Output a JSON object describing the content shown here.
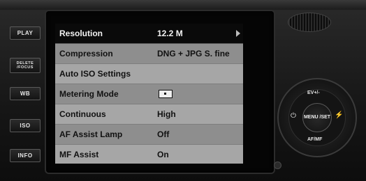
{
  "side_buttons": [
    {
      "label": "PLAY"
    },
    {
      "label": "DELETE /FOCUS"
    },
    {
      "label": "WB"
    },
    {
      "label": "ISO"
    },
    {
      "label": "INFO"
    }
  ],
  "menu": {
    "rows": [
      {
        "label": "Resolution",
        "value": "12.2 M"
      },
      {
        "label": "Compression",
        "value": "DNG + JPG S. fine"
      },
      {
        "label": "Auto ISO Settings",
        "value": ""
      },
      {
        "label": "Metering Mode",
        "value": ""
      },
      {
        "label": "Continuous",
        "value": "High"
      },
      {
        "label": "AF Assist Lamp",
        "value": "Off"
      },
      {
        "label": "MF Assist",
        "value": "On"
      }
    ],
    "selected_index": 0
  },
  "dpad": {
    "center": "MENU /SET",
    "up": "EV+/-",
    "down": "AF/MF",
    "left_icon": "self-timer-icon",
    "right_icon": "flash-icon"
  },
  "colors": {
    "selected_bg": "#0a0a0a",
    "row_light": "#a6a6a6",
    "row_dark": "#8e8e8e"
  }
}
